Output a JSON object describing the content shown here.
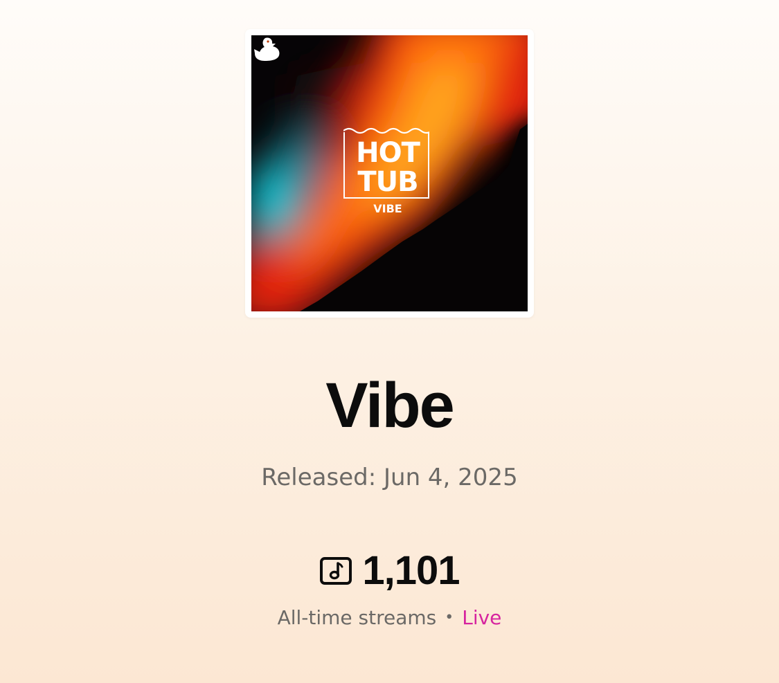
{
  "artwork": {
    "logo_line1": "HOT",
    "logo_line2": "TUB",
    "logo_sub": "VIBE",
    "icon": "duck-icon"
  },
  "release": {
    "title": "Vibe",
    "released_label": "Released: Jun 4, 2025"
  },
  "stats": {
    "icon": "music-note-icon",
    "streams": "1,101",
    "caption": "All-time streams",
    "separator": "•",
    "status": "Live"
  },
  "colors": {
    "live": "#d6249f",
    "title": "#0c0c0c",
    "muted": "#6b6966"
  }
}
